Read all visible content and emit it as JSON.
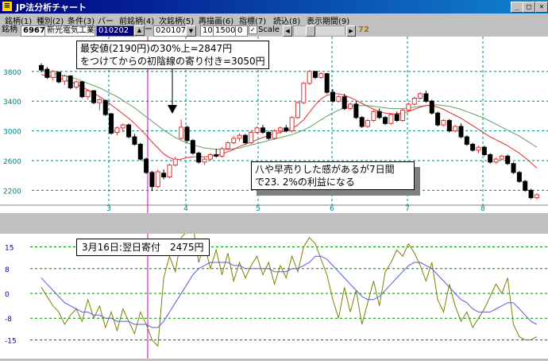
{
  "window": {
    "title": "JP法分析チャート"
  },
  "menu": [
    "銘柄(1)",
    "種別(2)",
    "条件(3)",
    "バー",
    "前銘柄(4)",
    "次銘柄(5)",
    "再描画(6)",
    "指標(7)",
    "読込(8)",
    "表示期間(9)"
  ],
  "toolbar": {
    "code_label": "銘柄",
    "code": "6967",
    "company": "新光電気工業",
    "date_from": "010202",
    "dash": "ー",
    "date_to": "020107",
    "param1": "10",
    "param2": "1500",
    "param3": "0",
    "scale_label": "Scale",
    "checkbox_mark": "✓",
    "value": "72"
  },
  "icons": {
    "dropdown": "▼",
    "scroll_left": "◀",
    "scroll_right": "▶",
    "minimize": "_",
    "maximize": "□",
    "close": "×",
    "app": "≡"
  },
  "colors": {
    "ma_short": "#d83030",
    "ma_long": "#60a060",
    "oscillator": "#808000",
    "signal": "#5a5ae0",
    "marker": "#d000d0",
    "grid_price": "#008080",
    "grid_osc": "#008000"
  },
  "price_chart": {
    "y_ticks": [
      "3800",
      "3400",
      "3000",
      "2600",
      "2200"
    ],
    "x_ticks": [
      "3",
      "4",
      "5",
      "6",
      "7",
      "8"
    ]
  },
  "osc_chart": {
    "y_ticks": [
      "15",
      "8",
      "0",
      "-8",
      "-15"
    ]
  },
  "annotations": {
    "note1_line1": "最安値(2190円)の30%上=2847円",
    "note1_line2": "をつけてからの初陰線の寄り付き=3050円",
    "note2_line1": "八や早売りした感があるが7日間",
    "note2_line2": "で23. 2%の利益になる",
    "note3": "3月16日:翌日寄付　2475円"
  },
  "chart_data": [
    {
      "type": "candlestick",
      "y_ticks": [
        3800,
        3400,
        3000,
        2600,
        2200
      ],
      "x_ticks": [
        "3",
        "4",
        "5",
        "6",
        "7",
        "8"
      ],
      "candles": [
        [
          3880,
          3910,
          3790,
          3820
        ],
        [
          3830,
          3860,
          3700,
          3720
        ],
        [
          3720,
          3820,
          3680,
          3800
        ],
        [
          3790,
          3800,
          3640,
          3660
        ],
        [
          3670,
          3760,
          3620,
          3740
        ],
        [
          3740,
          3750,
          3560,
          3580
        ],
        [
          3590,
          3680,
          3560,
          3660
        ],
        [
          3660,
          3670,
          3440,
          3460
        ],
        [
          3460,
          3560,
          3420,
          3540
        ],
        [
          3540,
          3550,
          3360,
          3380
        ],
        [
          3380,
          3440,
          3280,
          3420
        ],
        [
          3410,
          3420,
          3200,
          3220
        ],
        [
          3230,
          3240,
          2950,
          2970
        ],
        [
          2980,
          3060,
          2940,
          3040
        ],
        [
          3040,
          3100,
          2980,
          3080
        ],
        [
          3080,
          3100,
          2900,
          2920
        ],
        [
          2920,
          2960,
          2800,
          2820
        ],
        [
          2820,
          2840,
          2600,
          2620
        ],
        [
          2620,
          2640,
          2420,
          2440
        ],
        [
          2440,
          2460,
          2190,
          2250
        ],
        [
          2250,
          2480,
          2230,
          2450
        ],
        [
          2430,
          2480,
          2350,
          2380
        ],
        [
          2380,
          2560,
          2360,
          2540
        ],
        [
          2540,
          2650,
          2520,
          2620
        ],
        [
          2900,
          3150,
          2880,
          3050
        ],
        [
          3050,
          3070,
          2850,
          2870
        ],
        [
          2870,
          2890,
          2680,
          2700
        ],
        [
          2700,
          2720,
          2560,
          2580
        ],
        [
          2580,
          2640,
          2540,
          2620
        ],
        [
          2620,
          2700,
          2600,
          2680
        ],
        [
          2680,
          2760,
          2640,
          2660
        ],
        [
          2660,
          2780,
          2640,
          2760
        ],
        [
          2760,
          2860,
          2740,
          2840
        ],
        [
          2840,
          2930,
          2820,
          2900
        ],
        [
          2900,
          2970,
          2860,
          2940
        ],
        [
          2940,
          2960,
          2820,
          2840
        ],
        [
          2840,
          3000,
          2820,
          2980
        ],
        [
          2980,
          3060,
          2960,
          3040
        ],
        [
          3040,
          3080,
          2960,
          2980
        ],
        [
          2980,
          3000,
          2880,
          2900
        ],
        [
          2900,
          3020,
          2880,
          3000
        ],
        [
          3000,
          3060,
          2960,
          3040
        ],
        [
          3040,
          3080,
          2980,
          3000
        ],
        [
          3000,
          3200,
          2980,
          3180
        ],
        [
          3180,
          3400,
          3160,
          3380
        ],
        [
          3380,
          3660,
          3360,
          3640
        ],
        [
          3640,
          3820,
          3620,
          3800
        ],
        [
          3800,
          3810,
          3700,
          3720
        ],
        [
          3720,
          3790,
          3700,
          3770
        ],
        [
          3770,
          3780,
          3500,
          3520
        ],
        [
          3520,
          3560,
          3380,
          3400
        ],
        [
          3400,
          3480,
          3380,
          3460
        ],
        [
          3460,
          3500,
          3280,
          3300
        ],
        [
          3300,
          3380,
          3280,
          3360
        ],
        [
          3360,
          3400,
          3160,
          3180
        ],
        [
          3180,
          3200,
          3040,
          3060
        ],
        [
          3060,
          3160,
          3040,
          3140
        ],
        [
          3140,
          3280,
          3120,
          3260
        ],
        [
          3260,
          3300,
          3160,
          3180
        ],
        [
          3180,
          3200,
          3080,
          3100
        ],
        [
          3100,
          3240,
          3080,
          3220
        ],
        [
          3220,
          3260,
          3120,
          3140
        ],
        [
          3140,
          3300,
          3120,
          3280
        ],
        [
          3280,
          3380,
          3260,
          3360
        ],
        [
          3360,
          3460,
          3340,
          3440
        ],
        [
          3440,
          3520,
          3420,
          3500
        ],
        [
          3500,
          3540,
          3380,
          3400
        ],
        [
          3400,
          3420,
          3220,
          3240
        ],
        [
          3240,
          3260,
          3060,
          3080
        ],
        [
          3080,
          3160,
          3060,
          3140
        ],
        [
          3140,
          3160,
          2980,
          3000
        ],
        [
          3000,
          3080,
          2980,
          3060
        ],
        [
          3060,
          3100,
          2900,
          2920
        ],
        [
          2920,
          2940,
          2800,
          2820
        ],
        [
          2820,
          2840,
          2720,
          2740
        ],
        [
          2740,
          2800,
          2700,
          2780
        ],
        [
          2780,
          2800,
          2660,
          2680
        ],
        [
          2680,
          2700,
          2560,
          2580
        ],
        [
          2580,
          2640,
          2560,
          2620
        ],
        [
          2620,
          2680,
          2600,
          2660
        ],
        [
          2660,
          2680,
          2540,
          2560
        ],
        [
          2560,
          2580,
          2420,
          2440
        ],
        [
          2440,
          2460,
          2300,
          2320
        ],
        [
          2320,
          2340,
          2180,
          2200
        ],
        [
          2200,
          2220,
          2080,
          2100
        ],
        [
          2100,
          2160,
          2080,
          2140
        ]
      ],
      "ma_short": [
        3760,
        3740,
        3730,
        3710,
        3690,
        3660,
        3630,
        3590,
        3550,
        3510,
        3460,
        3410,
        3350,
        3290,
        3230,
        3170,
        3100,
        3020,
        2940,
        2850,
        2770,
        2690,
        2640,
        2610,
        2620,
        2640,
        2650,
        2650,
        2650,
        2660,
        2670,
        2690,
        2720,
        2750,
        2790,
        2820,
        2850,
        2880,
        2910,
        2940,
        2960,
        2980,
        3000,
        3030,
        3080,
        3150,
        3250,
        3350,
        3430,
        3480,
        3500,
        3500,
        3480,
        3450,
        3410,
        3370,
        3330,
        3290,
        3260,
        3240,
        3230,
        3230,
        3240,
        3260,
        3290,
        3320,
        3340,
        3340,
        3320,
        3290,
        3250,
        3210,
        3170,
        3120,
        3070,
        3020,
        2970,
        2920,
        2880,
        2840,
        2800,
        2750,
        2700,
        2640,
        2570,
        2500
      ],
      "ma_long": [
        3820,
        3800,
        3780,
        3760,
        3740,
        3720,
        3700,
        3670,
        3640,
        3610,
        3580,
        3540,
        3500,
        3460,
        3410,
        3360,
        3310,
        3250,
        3190,
        3130,
        3070,
        3010,
        2960,
        2910,
        2870,
        2840,
        2810,
        2790,
        2770,
        2760,
        2750,
        2750,
        2750,
        2760,
        2770,
        2790,
        2810,
        2830,
        2850,
        2870,
        2890,
        2910,
        2930,
        2950,
        2980,
        3010,
        3050,
        3100,
        3150,
        3200,
        3240,
        3280,
        3310,
        3330,
        3340,
        3340,
        3340,
        3330,
        3320,
        3310,
        3300,
        3300,
        3300,
        3310,
        3320,
        3330,
        3340,
        3350,
        3350,
        3340,
        3330,
        3310,
        3290,
        3260,
        3230,
        3200,
        3170,
        3130,
        3090,
        3050,
        3010,
        2970,
        2930,
        2880,
        2830,
        2780
      ]
    },
    {
      "type": "line",
      "y_ticks": [
        15,
        8,
        0,
        -8,
        -15
      ],
      "series": [
        {
          "values": [
            2,
            -1,
            -4,
            -6,
            -10,
            -7,
            -5,
            -9,
            -2,
            -8,
            -4,
            -11,
            -6,
            -12,
            -5,
            -9,
            -13,
            -6,
            -10,
            -15,
            -17,
            5,
            12,
            7,
            18,
            20,
            22,
            10,
            16,
            8,
            14,
            6,
            13,
            4,
            10,
            5,
            9,
            12,
            6,
            10,
            3,
            9,
            5,
            12,
            7,
            15,
            18,
            16,
            11,
            6,
            -2,
            -8,
            2,
            -6,
            1,
            -10,
            -3,
            4,
            -4,
            7,
            10,
            14,
            12,
            16,
            13,
            9,
            4,
            10,
            -2,
            -6,
            3,
            -4,
            -9,
            -6,
            -11,
            -8,
            -5,
            -1,
            3,
            0,
            5,
            -10,
            -14,
            -15,
            -15,
            -14
          ]
        },
        {
          "values": [
            5,
            3,
            1,
            -1,
            -3,
            -4,
            -5,
            -6,
            -6,
            -7,
            -7,
            -8,
            -8,
            -9,
            -9,
            -9,
            -10,
            -10,
            -10,
            -11,
            -11,
            -9,
            -6,
            -3,
            0,
            3,
            6,
            8,
            9,
            10,
            10,
            10,
            10,
            9,
            9,
            8,
            8,
            8,
            8,
            8,
            7,
            7,
            7,
            8,
            8,
            9,
            10,
            12,
            12,
            11,
            9,
            7,
            5,
            3,
            1,
            -1,
            -2,
            -2,
            -1,
            1,
            3,
            5,
            7,
            9,
            10,
            10,
            9,
            8,
            6,
            4,
            2,
            0,
            -2,
            -3,
            -5,
            -6,
            -6,
            -6,
            -5,
            -4,
            -3,
            -3,
            -5,
            -7,
            -9,
            -10
          ]
        }
      ]
    }
  ]
}
